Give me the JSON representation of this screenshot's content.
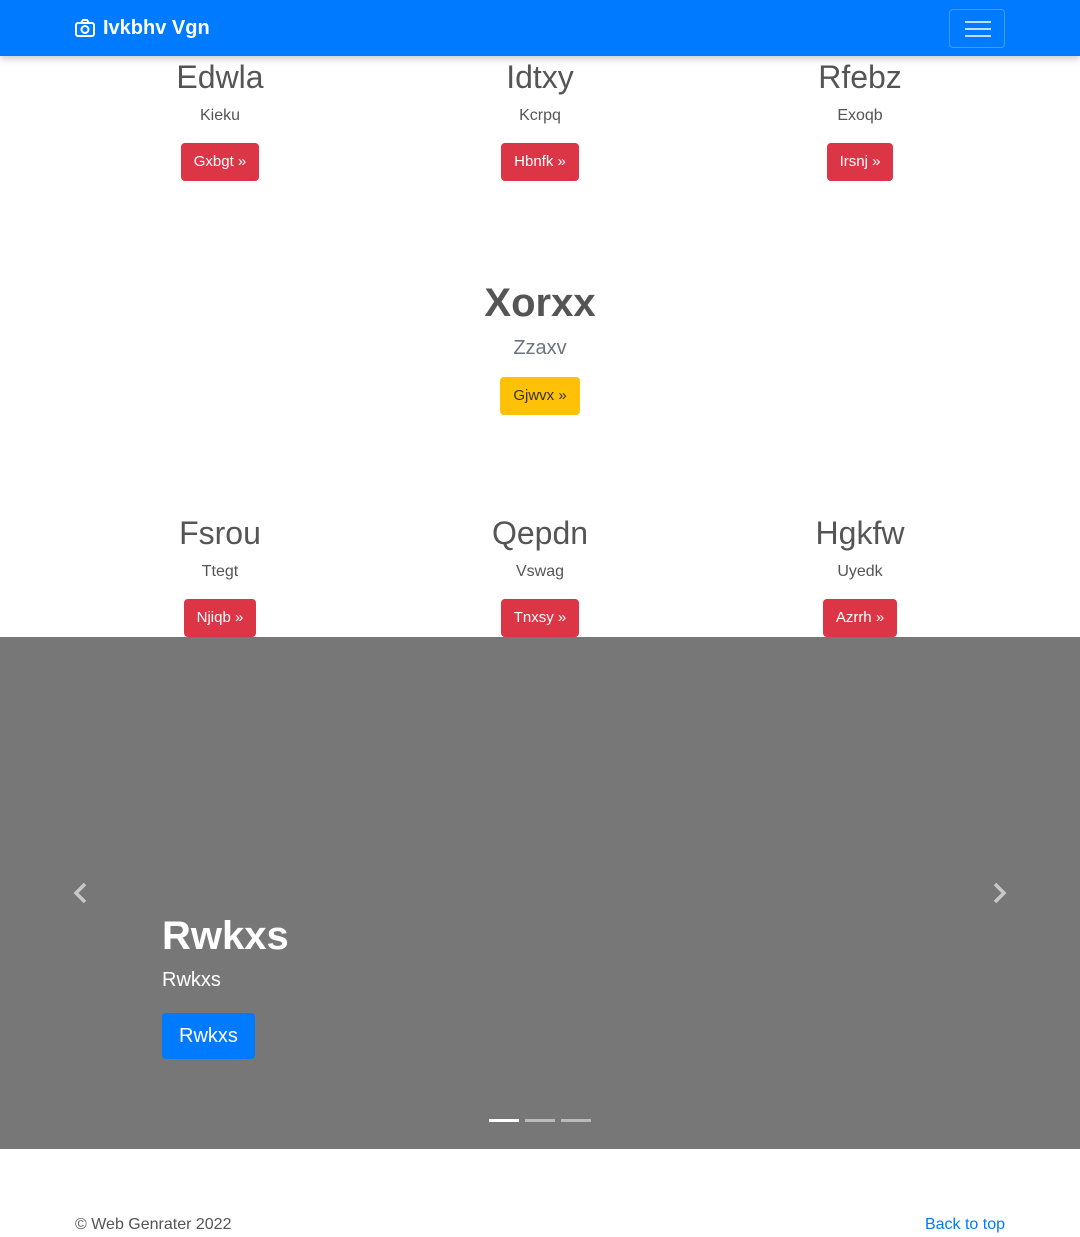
{
  "navbar": {
    "brand": "Ivkbhv Vgn",
    "brand_icon": "camera-icon",
    "toggler_icon": "hamburger-menu-icon"
  },
  "top_features": [
    {
      "heading": "Edwla",
      "text": "Kieku",
      "button": "Gxbgt »"
    },
    {
      "heading": "Idtxy",
      "text": "Kcrpq",
      "button": "Hbnfk »"
    },
    {
      "heading": "Rfebz",
      "text": "Exoqb",
      "button": "Irsnj »"
    }
  ],
  "center": {
    "heading": "Xorxx",
    "lead": "Zzaxv",
    "button": "Gjwvx »"
  },
  "bottom_features": [
    {
      "heading": "Fsrou",
      "text": "Ttegt",
      "button": "Njiqb »"
    },
    {
      "heading": "Qepdn",
      "text": "Vswag",
      "button": "Tnxsy »"
    },
    {
      "heading": "Hgkfw",
      "text": "Uyedk",
      "button": "Azrrh »"
    }
  ],
  "carousel": {
    "heading": "Rwkxs",
    "text": "Rwkxs",
    "button": "Rwkxs",
    "prev_icon": "chevron-left-icon",
    "next_icon": "chevron-right-icon",
    "slide_count": 3,
    "active_slide": 1
  },
  "footer": {
    "copyright": "© Web Genrater 2022",
    "back_to_top": "Back to top"
  },
  "colors": {
    "primary": "#007bff",
    "danger": "#dc3545",
    "warning": "#ffc107",
    "carousel_bg": "#777777"
  }
}
